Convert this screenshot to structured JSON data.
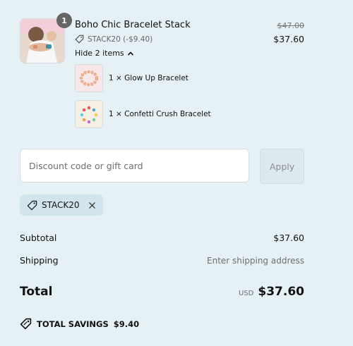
{
  "product": {
    "title": "Boho Chic Bracelet Stack",
    "quantity": "1",
    "discount_text": "STACK20 (-$9.40)",
    "original_price": "$47.00",
    "sale_price": "$37.60",
    "toggle_label": "Hide 2 items",
    "items": [
      {
        "label": "1 × Glow Up Bracelet"
      },
      {
        "label": "1 × Confetti Crush Bracelet"
      }
    ]
  },
  "discount": {
    "placeholder": "Discount code or gift card",
    "value": "",
    "apply_label": "Apply",
    "applied_code": "STACK20"
  },
  "summary": {
    "subtotal_label": "Subtotal",
    "subtotal_value": "$37.60",
    "shipping_label": "Shipping",
    "shipping_value": "Enter shipping address",
    "total_label": "Total",
    "currency": "USD",
    "total_value": "$37.60",
    "savings_label": "TOTAL SAVINGS",
    "savings_value": "$9.40"
  },
  "icons": {
    "tag": "tag-icon",
    "chevron": "chevron-up-icon",
    "remove": "close-icon",
    "savings": "tag-icon"
  },
  "colors": {
    "background": "#e5f1f4",
    "chip": "#d2e5ec",
    "badge": "#666666"
  }
}
